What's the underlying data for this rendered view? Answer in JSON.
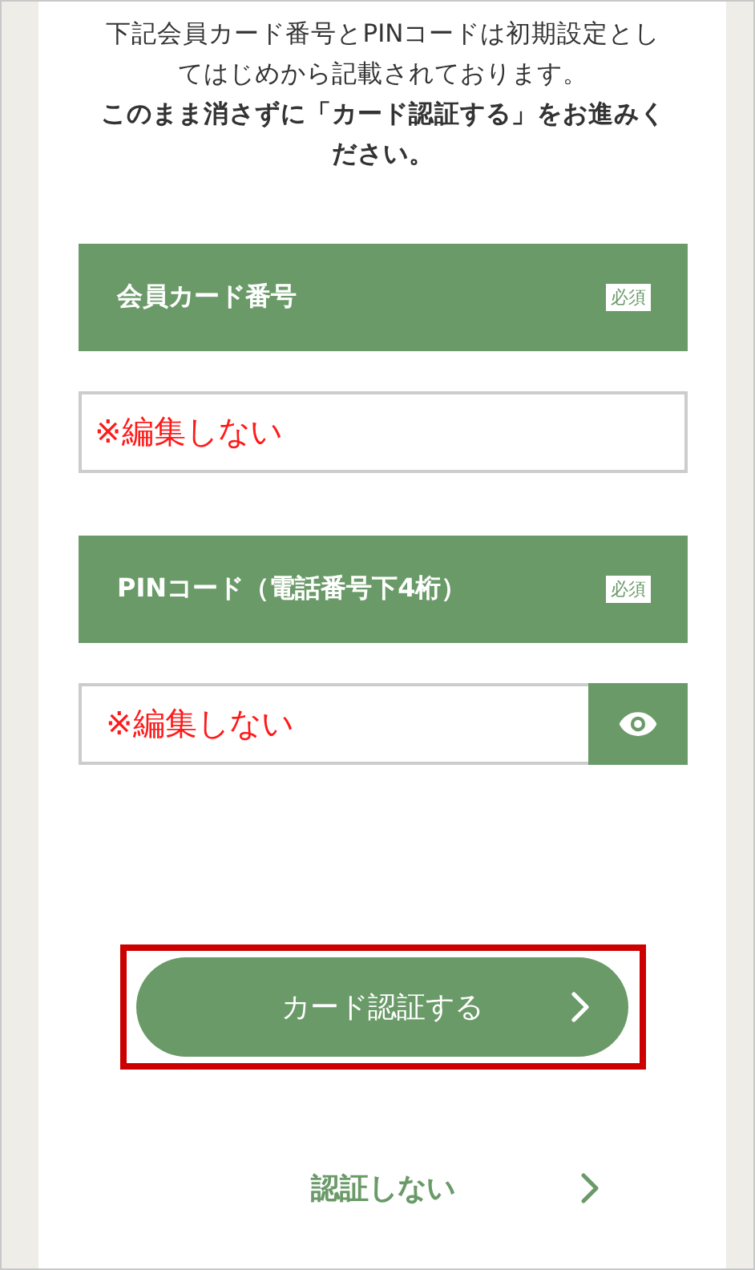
{
  "intro": {
    "notice": "下記会員カード番号とPINコードは初期設定としてはじめから記載されております。",
    "instruction": "このまま消さずに「カード認証する」をお進みください。"
  },
  "fields": [
    {
      "kind": "text",
      "label": "会員カード番号",
      "badge": "必須",
      "value": "※編集しない"
    },
    {
      "kind": "password",
      "label": "PINコード（電話番号下4桁）",
      "badge": "必須",
      "value": "※編集しない"
    }
  ],
  "primary_button": {
    "label": "カード認証する",
    "highlighted": true
  },
  "secondary_link": {
    "label": "認証しない"
  }
}
